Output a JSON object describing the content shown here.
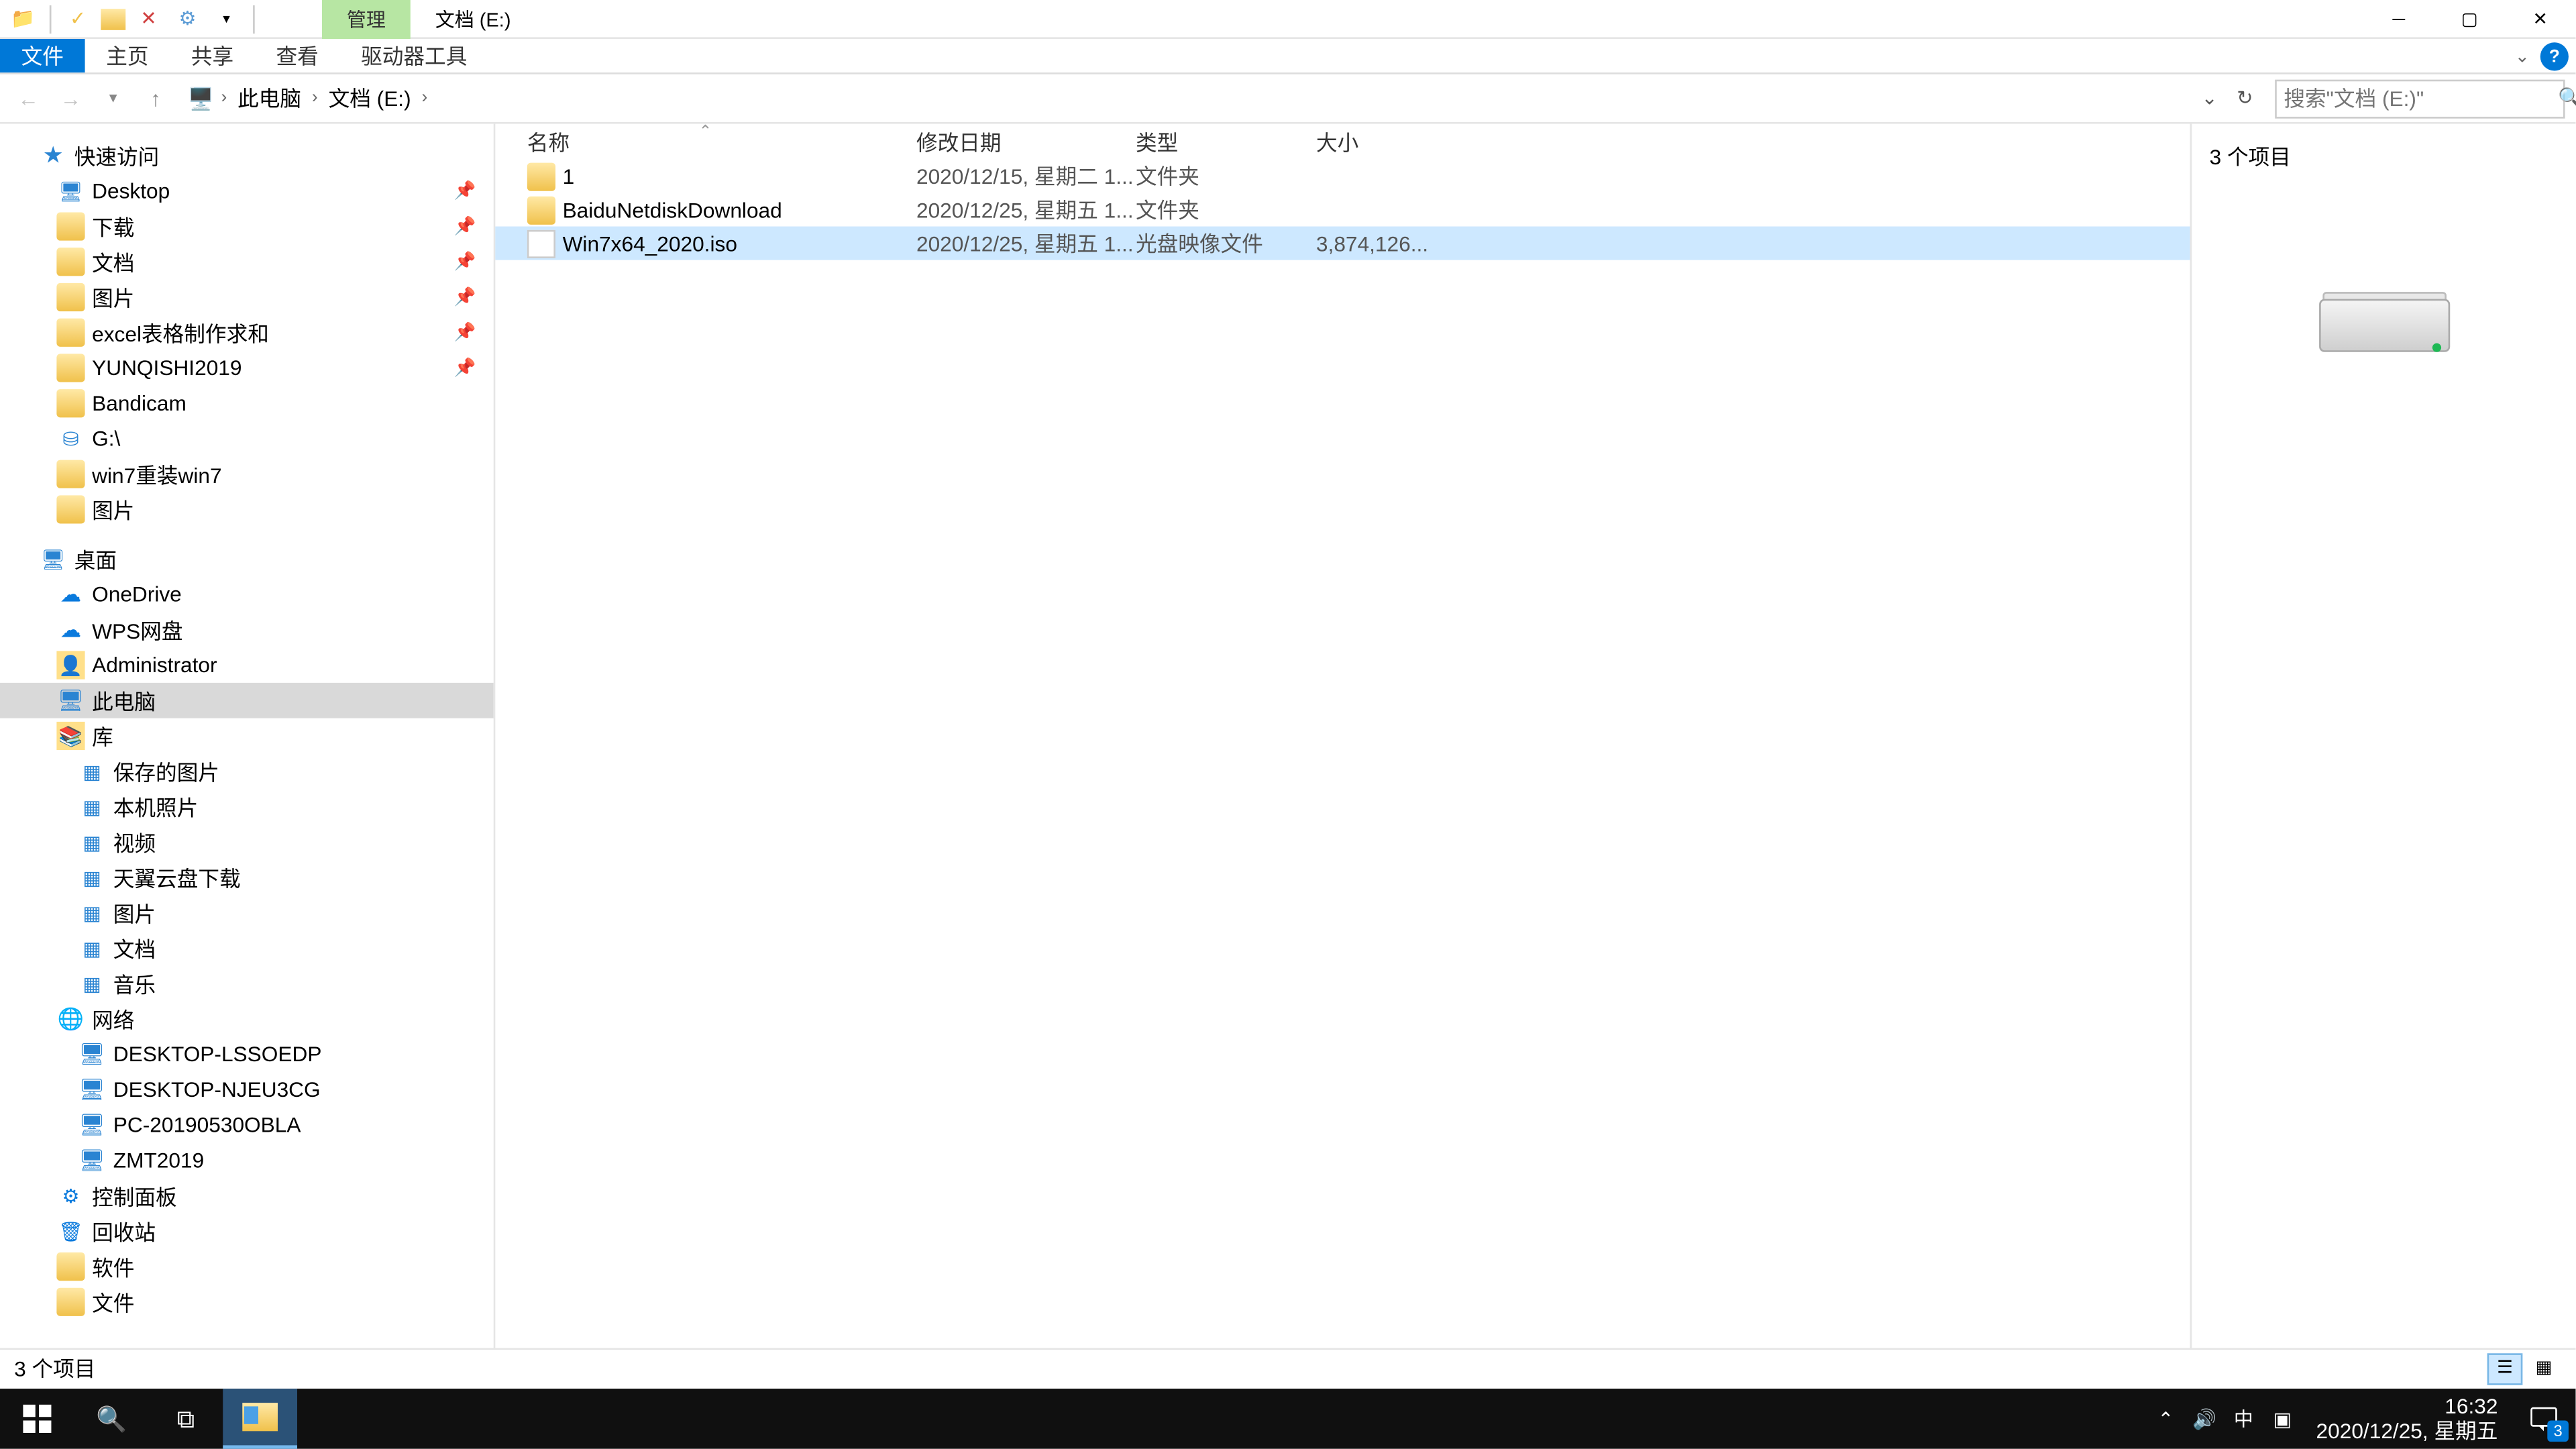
{
  "titlebar": {
    "manage_tab": "管理",
    "title": "文档 (E:)"
  },
  "ribbon": {
    "file": "文件",
    "home": "主页",
    "share": "共享",
    "view": "查看",
    "drive_tools": "驱动器工具"
  },
  "breadcrumb": {
    "this_pc": "此电脑",
    "volume": "文档 (E:)"
  },
  "search": {
    "placeholder": "搜索\"文档 (E:)\""
  },
  "nav": {
    "quick_access": "快速访问",
    "qa_items": [
      {
        "label": "Desktop",
        "pin": true,
        "kind": "desktop"
      },
      {
        "label": "下载",
        "pin": true,
        "kind": "folder"
      },
      {
        "label": "文档",
        "pin": true,
        "kind": "folder"
      },
      {
        "label": "图片",
        "pin": true,
        "kind": "folder"
      },
      {
        "label": "excel表格制作求和",
        "pin": true,
        "kind": "folder"
      },
      {
        "label": "YUNQISHI2019",
        "pin": true,
        "kind": "folder"
      },
      {
        "label": "Bandicam",
        "pin": false,
        "kind": "folder"
      },
      {
        "label": "G:\\",
        "pin": false,
        "kind": "drive"
      },
      {
        "label": "win7重装win7",
        "pin": false,
        "kind": "folder"
      },
      {
        "label": "图片",
        "pin": false,
        "kind": "folder"
      }
    ],
    "desktop": "桌面",
    "desktop_items": [
      {
        "label": "OneDrive",
        "kind": "cloud"
      },
      {
        "label": "WPS网盘",
        "kind": "cloud"
      },
      {
        "label": "Administrator",
        "kind": "user"
      },
      {
        "label": "此电脑",
        "kind": "pc",
        "sel": true
      },
      {
        "label": "库",
        "kind": "lib"
      }
    ],
    "lib_items": [
      {
        "label": "保存的图片"
      },
      {
        "label": "本机照片"
      },
      {
        "label": "视频"
      },
      {
        "label": "天翼云盘下载"
      },
      {
        "label": "图片"
      },
      {
        "label": "文档"
      },
      {
        "label": "音乐"
      }
    ],
    "network": "网络",
    "net_items": [
      {
        "label": "DESKTOP-LSSOEDP"
      },
      {
        "label": "DESKTOP-NJEU3CG"
      },
      {
        "label": "PC-20190530OBLA"
      },
      {
        "label": "ZMT2019"
      }
    ],
    "tail_items": [
      {
        "label": "控制面板",
        "kind": "cpl"
      },
      {
        "label": "回收站",
        "kind": "recycle"
      },
      {
        "label": "软件",
        "kind": "folder"
      },
      {
        "label": "文件",
        "kind": "folder"
      }
    ]
  },
  "columns": {
    "name": "名称",
    "date": "修改日期",
    "type": "类型",
    "size": "大小"
  },
  "files": [
    {
      "name": "1",
      "date": "2020/12/15, 星期二 1...",
      "type": "文件夹",
      "size": "",
      "kind": "folder"
    },
    {
      "name": "BaiduNetdiskDownload",
      "date": "2020/12/25, 星期五 1...",
      "type": "文件夹",
      "size": "",
      "kind": "folder"
    },
    {
      "name": "Win7x64_2020.iso",
      "date": "2020/12/25, 星期五 1...",
      "type": "光盘映像文件",
      "size": "3,874,126...",
      "kind": "file",
      "sel": true
    }
  ],
  "preview": {
    "title": "3 个项目"
  },
  "status": {
    "text": "3 个项目"
  },
  "tray": {
    "ime": "中",
    "time": "16:32",
    "date": "2020/12/25, 星期五",
    "notif_count": "3"
  }
}
